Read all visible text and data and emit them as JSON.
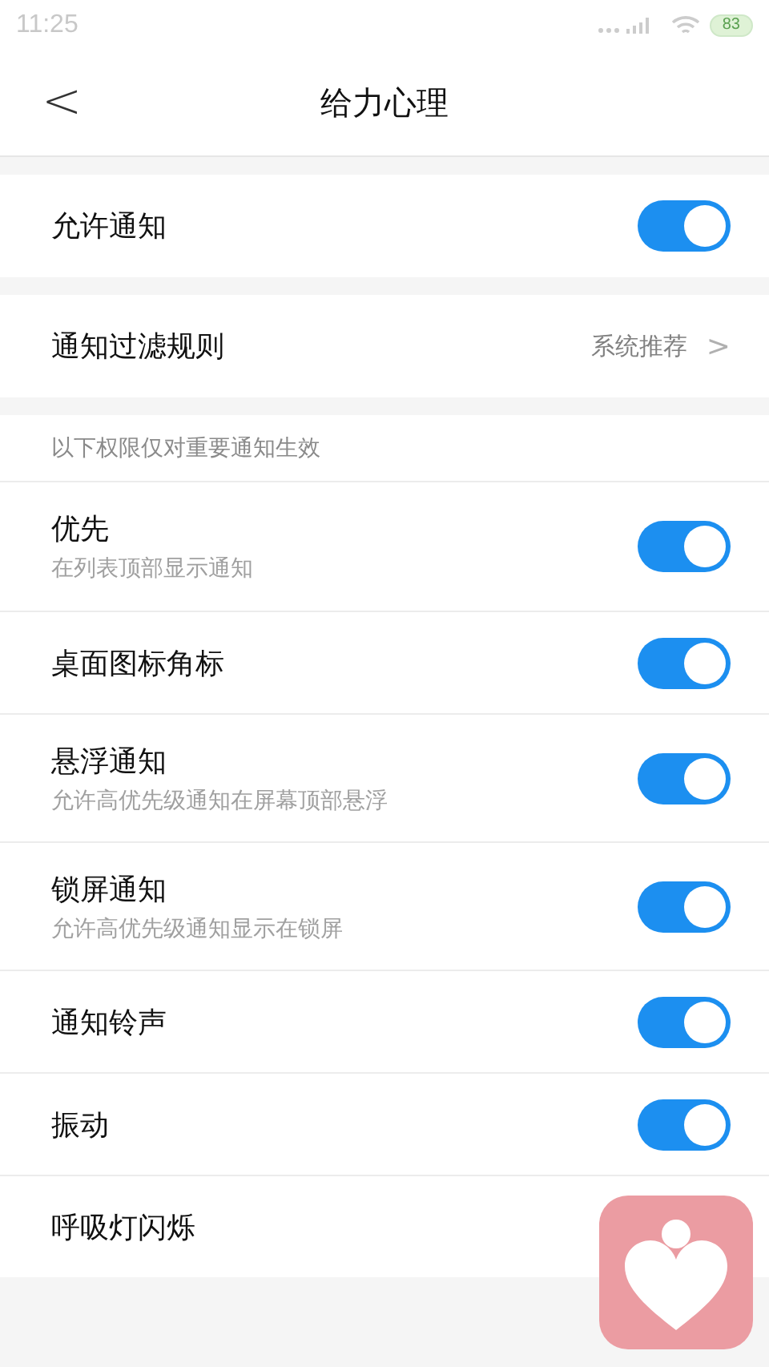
{
  "status_bar": {
    "time": "11:25",
    "battery": "83"
  },
  "header": {
    "back": "<",
    "title": "给力心理"
  },
  "groups": [
    {
      "rows": [
        {
          "kind": "switch",
          "label": "允许通知",
          "on": true
        }
      ]
    },
    {
      "rows": [
        {
          "kind": "link",
          "label": "通知过滤规则",
          "value": "系统推荐",
          "chevron": ">"
        }
      ]
    }
  ],
  "section": {
    "caption": "以下权限仅对重要通知生效",
    "rows": [
      {
        "kind": "switch",
        "label": "优先",
        "subtitle": "在列表顶部显示通知",
        "on": true
      },
      {
        "kind": "switch",
        "label": "桌面图标角标",
        "on": true
      },
      {
        "kind": "switch",
        "label": "悬浮通知",
        "subtitle": "允许高优先级通知在屏幕顶部悬浮",
        "on": true
      },
      {
        "kind": "switch",
        "label": "锁屏通知",
        "subtitle": "允许高优先级通知显示在锁屏",
        "on": true
      },
      {
        "kind": "switch",
        "label": "通知铃声",
        "on": true
      },
      {
        "kind": "switch",
        "label": "振动",
        "on": true
      },
      {
        "kind": "plain",
        "label": "呼吸灯闪烁"
      }
    ]
  }
}
